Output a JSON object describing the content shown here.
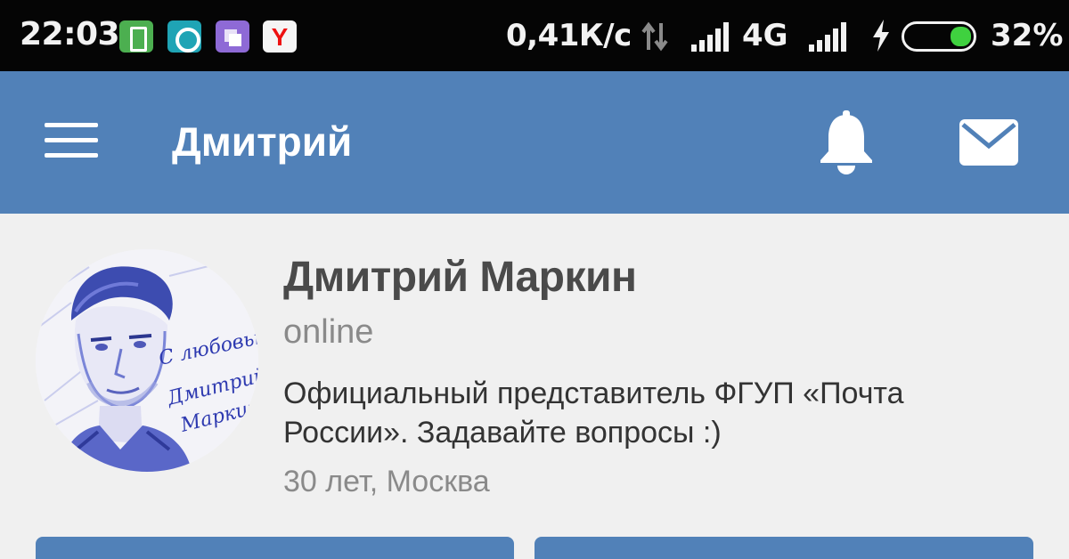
{
  "status_bar": {
    "time": "22:03",
    "net_speed": "0,41К/с",
    "network_type": "4G",
    "battery_percent": "32%",
    "battery_level": 0.32,
    "notification_icons": [
      "battery-app-icon",
      "teal-app-icon",
      "purple-app-icon",
      "yandex-browser-icon"
    ],
    "yandex_letter": "Y"
  },
  "app_bar": {
    "title": "Дмитрий",
    "color": "#5181b8"
  },
  "profile": {
    "name": "Дмитрий Маркин",
    "status": "online",
    "bio": "Официальный представитель ФГУП «Почта России». Задавайте вопросы :)",
    "meta": "30 лет, Москва",
    "avatar_signature": [
      "С любовью,",
      "Дмитрий",
      "Маркин"
    ]
  }
}
